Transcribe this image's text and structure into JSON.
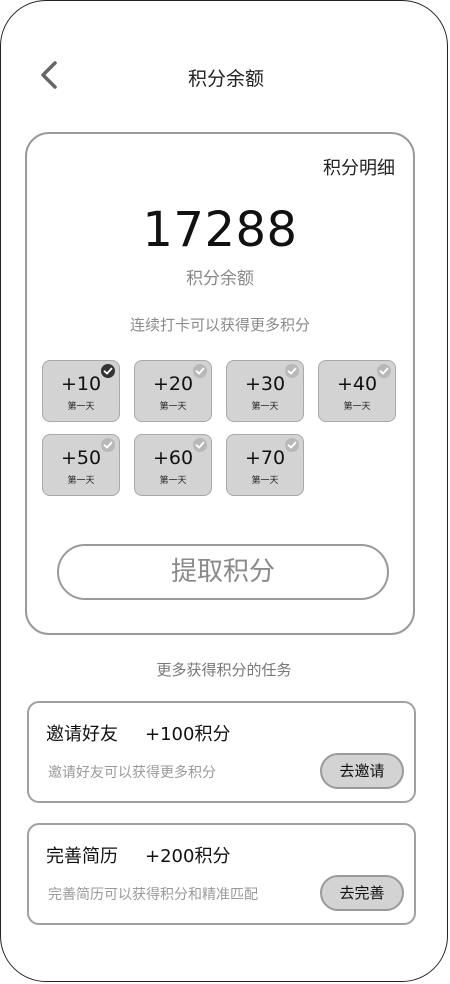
{
  "header": {
    "title": "积分余额",
    "back_icon": "chevron-left-icon"
  },
  "balance_card": {
    "detail_link": "积分明细",
    "balance": "17288",
    "balance_label": "积分余额",
    "hint": "连续打卡可以获得更多积分",
    "checkins": [
      {
        "points": "+10",
        "day": "第一天",
        "checked": true
      },
      {
        "points": "+20",
        "day": "第一天",
        "checked": false
      },
      {
        "points": "+30",
        "day": "第一天",
        "checked": false
      },
      {
        "points": "+40",
        "day": "第一天",
        "checked": false
      },
      {
        "points": "+50",
        "day": "第一天",
        "checked": false
      },
      {
        "points": "+60",
        "day": "第一天",
        "checked": false
      },
      {
        "points": "+70",
        "day": "第一天",
        "checked": false
      }
    ],
    "claim_button": "提取积分"
  },
  "tasks_section": {
    "title": "更多获得积分的任务",
    "tasks": [
      {
        "name": "邀请好友",
        "reward": "+100积分",
        "description": "邀请好友可以获得更多积分",
        "button": "去邀请"
      },
      {
        "name": "完善简历",
        "reward": "+200积分",
        "description": "完善简历可以获得积分和精准匹配",
        "button": "去完善"
      }
    ]
  },
  "colors": {
    "tile_bg": "#d3d3d3",
    "border": "#9a9a9a",
    "muted_text": "#8a8a8a",
    "check_active": "#333333",
    "check_inactive": "#b8b8b8"
  }
}
